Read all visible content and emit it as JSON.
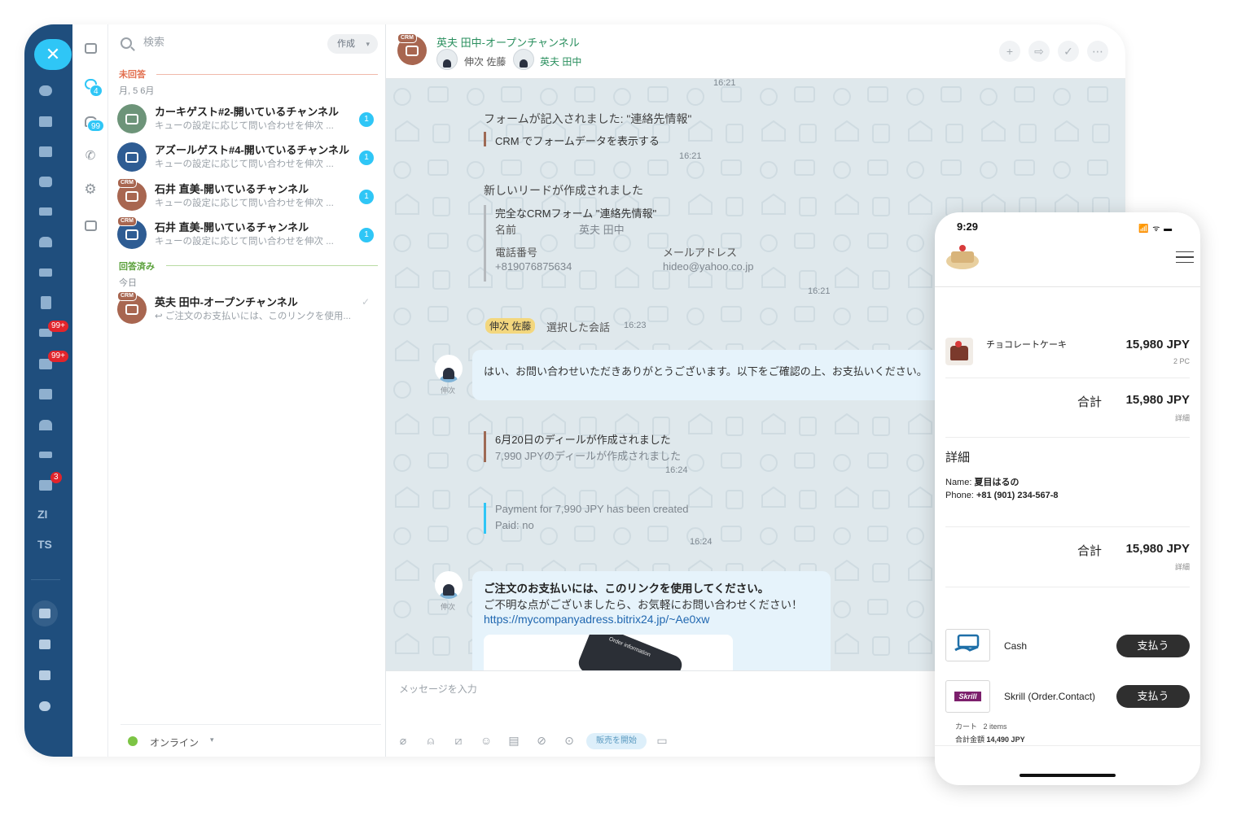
{
  "colors": {
    "rail": "#1f4e7d",
    "accent": "#2fc6f6",
    "crm": "#a86650",
    "green": "#2a8f5e",
    "unanswered": "#e26f4f",
    "answered": "#7cc444"
  },
  "rail": {
    "close_icon": "close-icon",
    "icons": [
      "openlines-icon",
      "feed-icon",
      "calendar-icon",
      "chat-icon",
      "mail-icon",
      "groups-icon",
      "drive-icon",
      "docs-icon",
      "tasks-icon",
      "checklist-icon",
      "contact-center-icon",
      "home-icon",
      "sign-icon",
      "crm-printer-icon"
    ],
    "badges": [
      "99+",
      "99+",
      "3"
    ],
    "text_items": [
      "ZI",
      "TS"
    ],
    "bottom_icons": [
      "cart-icon",
      "box-icon",
      "robot-icon",
      "more-icon"
    ]
  },
  "col2": {
    "badges": [
      "4",
      "99"
    ]
  },
  "search": {
    "placeholder": "検索"
  },
  "create_label": "作成",
  "unanswered": {
    "label": "未回答",
    "date": "月, 5 6月"
  },
  "answered": {
    "label": "回答済み",
    "date": "今日"
  },
  "crm_tag": "CRM",
  "conversations": [
    {
      "title": "カーキゲスト#2-開いているチャンネル",
      "subtitle": "キューの設定に応じて問い合わせを伸次 ...",
      "count": "1"
    },
    {
      "title": "アズールゲスト#4-開いているチャンネル",
      "subtitle": "キューの設定に応じて問い合わせを伸次 ...",
      "count": "1"
    },
    {
      "title": "石井 直美-開いているチャンネル",
      "subtitle": "キューの設定に応じて問い合わせを伸次 ...",
      "count": "1"
    },
    {
      "title": "石井 直美-開いているチャンネル",
      "subtitle": "キューの設定に応じて問い合わせを伸次 ...",
      "count": "1"
    },
    {
      "title": "英夫 田中-オープンチャンネル",
      "subtitle": "ご注文のお支払いには、このリンクを使用...",
      "check": "✓"
    }
  ],
  "status": {
    "label": "オンライン"
  },
  "chat": {
    "title": "英夫 田中-オープンチャンネル",
    "members": [
      "伸次 佐藤",
      "英夫 田中"
    ],
    "header_buttons": [
      "+",
      "⇨",
      "✓",
      "⋯"
    ],
    "messages": {
      "t0": "16:21",
      "form_title": "フォームが記入されました: \"連絡先情報\"",
      "form_link": "CRM でフォームデータを表示する",
      "t1": "16:21",
      "lead_title": "新しいリードが作成されました",
      "lead_form": "完全なCRMフォーム \"連絡先情報\"",
      "name_label": "名前",
      "name_value": "英夫 田中",
      "phone_label": "電話番号",
      "phone_value": "+819076875634",
      "email_label": "メールアドレス",
      "email_value": "hideo@yahoo.co.jp",
      "t2": "16:21",
      "select_user": "伸次 佐藤",
      "select_text": "選択した会話",
      "t3": "16:23",
      "sender": "伸次",
      "reply": "はい、お問い合わせいただきありがとうございます。以下をご確認の上、お支払いください。",
      "deal_title": "6月20日のディールが作成されました",
      "deal_sub": "7,990 JPYのディールが作成されました",
      "t4": "16:24",
      "payment_line1": "Payment for 7,990 JPY has been created",
      "payment_line2": "Paid: no",
      "t5": "16:24",
      "pay_msg1": "ご注文のお支払いには、このリンクを使用してください。",
      "pay_msg2": "ご不明な点がございましたら、お気軽にお問い合わせください！",
      "pay_link": "https://mycompanyadress.bitrix24.jp/~Ae0xw",
      "image_text": "Order information"
    },
    "input_placeholder": "メッセージを入力",
    "tools": [
      "paperclip-icon",
      "contact-icon",
      "slash-icon",
      "smile-icon",
      "template-icon",
      "hide-icon",
      "sale-icon",
      "screen-icon"
    ],
    "start_sale": "販売を開始"
  },
  "phone": {
    "time": "9:29",
    "status_icons": "📶 ᯤ ▬",
    "product_name": "チョコレートケーキ",
    "product_price": "15,980 JPY",
    "product_qty": "2 PC",
    "total_label": "合計",
    "total_value": "15,980 JPY",
    "details_small": "詳細",
    "details_title": "詳細",
    "name_label": "Name:",
    "name_value": "夏目はるの",
    "phone_label": "Phone:",
    "phone_value": "+81 (901) 234-567-8",
    "total2_label": "合計",
    "total2_value": "15,980 JPY",
    "details_small2": "詳細",
    "pay1_name": "Cash",
    "pay1_btn": "支払う",
    "pay2_logo": "Skrill",
    "pay2_name": "Skrill (Order.Contact)",
    "pay2_btn": "支払う",
    "cart_label": "カート",
    "cart_items": "2 items",
    "sum_label": "合計金額",
    "sum_value": "14,490 JPY"
  }
}
